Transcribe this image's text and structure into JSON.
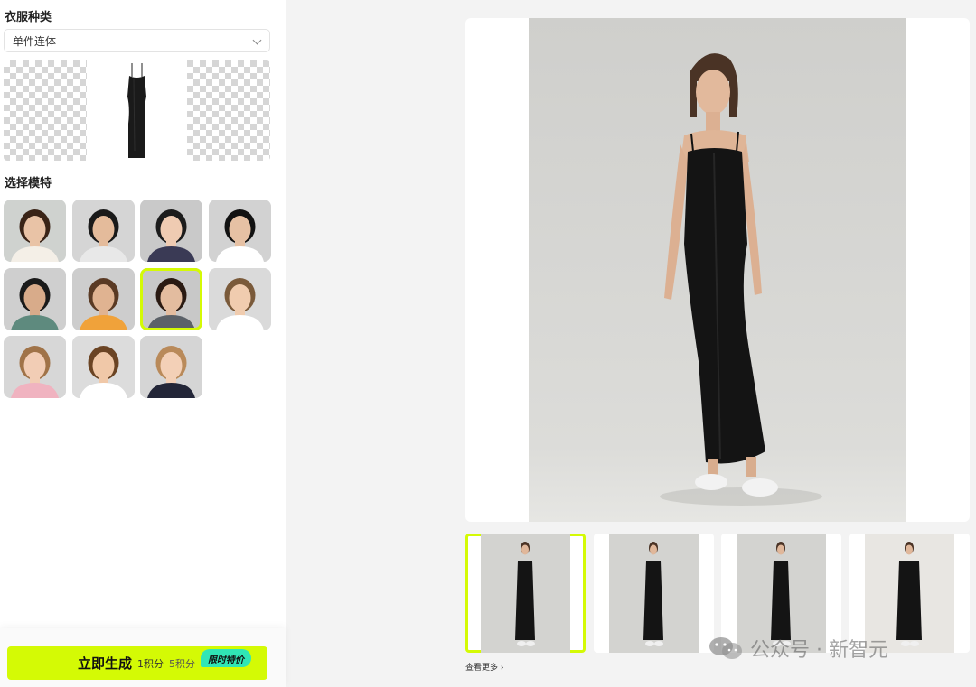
{
  "left_panel": {
    "clothing_type_title": "衣服种类",
    "clothing_type_value": "单件连体",
    "model_section_title": "选择模特",
    "models": [
      {
        "id": "female-1",
        "skin": "#e9c3a6",
        "hair": "#3a2417",
        "top": "#f4efe7",
        "bg": "#cfd2cf"
      },
      {
        "id": "male-1",
        "skin": "#e4bb9b",
        "hair": "#1a1a1a",
        "top": "#e8e8e8",
        "bg": "#d5d5d5"
      },
      {
        "id": "female-2",
        "skin": "#efcbb2",
        "hair": "#1c1c1c",
        "top": "#3a3a55",
        "bg": "#c9c9c9"
      },
      {
        "id": "male-2",
        "skin": "#e6c1a4",
        "hair": "#121212",
        "top": "#ffffff",
        "bg": "#d2d2d2"
      },
      {
        "id": "female-3",
        "skin": "#d8ab8a",
        "hair": "#1a1a1a",
        "top": "#5e8a7e",
        "bg": "#cfcfcf"
      },
      {
        "id": "male-3",
        "skin": "#e0b391",
        "hair": "#5a3a24",
        "top": "#f0a23a",
        "bg": "#cdcdcd"
      },
      {
        "id": "female-4",
        "skin": "#e3bc9f",
        "hair": "#2a1a12",
        "top": "#5b6168",
        "bg": "#c8c8c8"
      },
      {
        "id": "boy-1",
        "skin": "#f0ccaf",
        "hair": "#7a5a3a",
        "top": "#ffffff",
        "bg": "#dadada"
      },
      {
        "id": "girl-1",
        "skin": "#f2cdb5",
        "hair": "#a07348",
        "top": "#f0b3c0",
        "bg": "#d7d7d7"
      },
      {
        "id": "boy-2",
        "skin": "#f0c8a8",
        "hair": "#6b4424",
        "top": "#ffffff",
        "bg": "#dcdcdc"
      },
      {
        "id": "girl-2",
        "skin": "#f3d0b7",
        "hair": "#b98a5a",
        "top": "#232638",
        "bg": "#d5d5d5"
      }
    ],
    "selected_model_index": 6,
    "generate_label": "立即生成",
    "cost_now": "1积分",
    "cost_original": "5积分",
    "promo_badge": "限时特价"
  },
  "main": {
    "see_more": "查看更多 ›",
    "selected_thumb_index": 0,
    "thumbnails": [
      {
        "id": "result-1"
      },
      {
        "id": "result-2"
      },
      {
        "id": "result-3"
      },
      {
        "id": "result-4"
      }
    ]
  },
  "watermark": {
    "text": "公众号 · 新智元"
  },
  "colors": {
    "accent": "#d4fa05",
    "promo": "#30e6b5",
    "dress": "#151515"
  }
}
